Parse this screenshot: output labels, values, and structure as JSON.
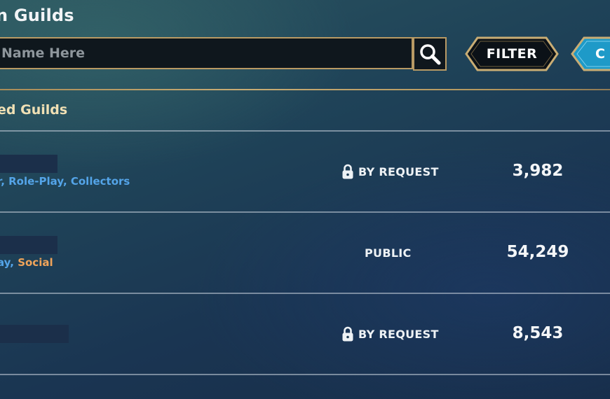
{
  "page": {
    "title": "n Guilds"
  },
  "search": {
    "placeholder": "Name Here",
    "value": ""
  },
  "toolbar": {
    "filter_label": "FILTER",
    "create_label": "C",
    "search_icon": "magnifier-icon"
  },
  "section": {
    "title": "ed Guilds"
  },
  "guilds": [
    {
      "tags": [
        {
          "text": "r",
          "color": "#54a4e8"
        },
        {
          "text": "Role-Play",
          "color": "#54a4e8"
        },
        {
          "text": "Collectors",
          "color": "#54a4e8"
        }
      ],
      "access": "BY REQUEST",
      "locked": true,
      "members": "3,982"
    },
    {
      "tags": [
        {
          "text": "ay",
          "color": "#54a4e8"
        },
        {
          "text": "Social",
          "color": "#f0a45a"
        }
      ],
      "access": "PUBLIC",
      "locked": false,
      "members": "54,249"
    },
    {
      "tags": [],
      "access": "BY REQUEST",
      "locked": true,
      "members": "8,543"
    }
  ],
  "colors": {
    "gold_border": "#b89a64",
    "section_title": "#f0e0b4",
    "tag_blue": "#54a4e8",
    "tag_orange": "#f0a45a",
    "create_accent": "#1e9ac8"
  }
}
